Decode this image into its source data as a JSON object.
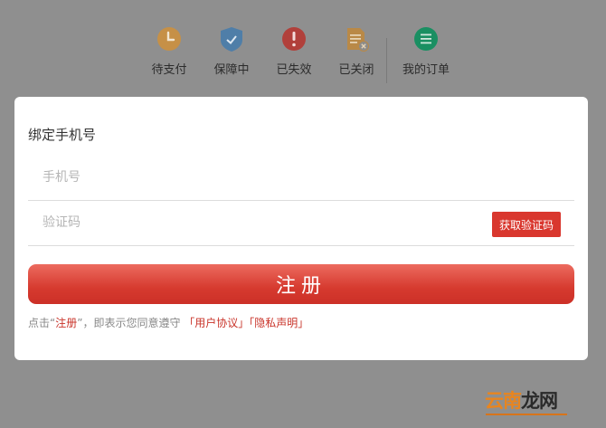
{
  "status_bar": {
    "items": [
      {
        "label": "待支付",
        "icon": "clock-icon",
        "color": "#c69047"
      },
      {
        "label": "保障中",
        "icon": "shield-icon",
        "color": "#4f7ea8"
      },
      {
        "label": "已失效",
        "icon": "alert-icon",
        "color": "#b1403b"
      },
      {
        "label": "已关闭",
        "icon": "document-closed-icon",
        "color": "#b98947"
      },
      {
        "label": "我的订单",
        "icon": "order-list-icon",
        "color": "#1a8f62"
      }
    ]
  },
  "modal": {
    "title": "绑定手机号",
    "phone_placeholder": "手机号",
    "code_placeholder": "验证码",
    "get_code_label": "获取验证码",
    "register_label": "注册",
    "agreement": {
      "prefix": "点击“",
      "register_word": "注册",
      "middle": "”，即表示您同意遵守",
      "user_agreement": "「用户协议」",
      "privacy_policy": "「隐私声明」"
    }
  },
  "watermark": {
    "part1": "云南",
    "part2": "龙网"
  },
  "colors": {
    "accent": "#d9372e",
    "overlay": "#8f8f8f"
  }
}
